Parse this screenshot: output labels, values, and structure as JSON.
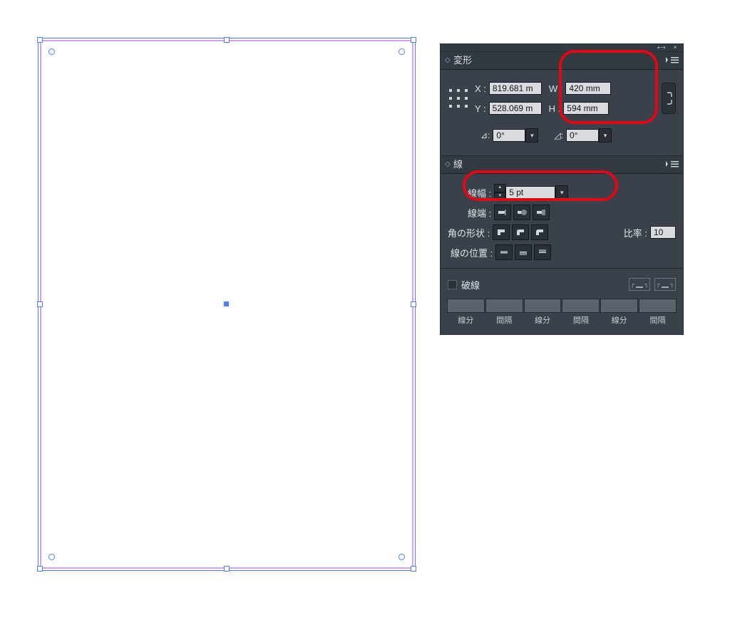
{
  "transform_panel": {
    "title": "変形",
    "x_label": "X :",
    "y_label": "Y :",
    "w_label": "W :",
    "h_label": "H :",
    "x_value": "819.681 m",
    "y_value": "528.069 m",
    "w_value": "420 mm",
    "h_value": "594 mm",
    "rotate_label": "⊿:",
    "rotate_value": "0°",
    "shear_label": "◿:",
    "shear_value": "0°"
  },
  "stroke_panel": {
    "title": "線",
    "weight_label": "線幅 :",
    "weight_value": "5 pt",
    "cap_label": "線端 :",
    "corner_label": "角の形状 :",
    "miter_label": "比率 :",
    "miter_value": "10",
    "align_label": "線の位置 :",
    "dashed_label": "破線",
    "dash_captions": [
      "線分",
      "間隔",
      "線分",
      "間隔",
      "線分",
      "間隔"
    ]
  }
}
